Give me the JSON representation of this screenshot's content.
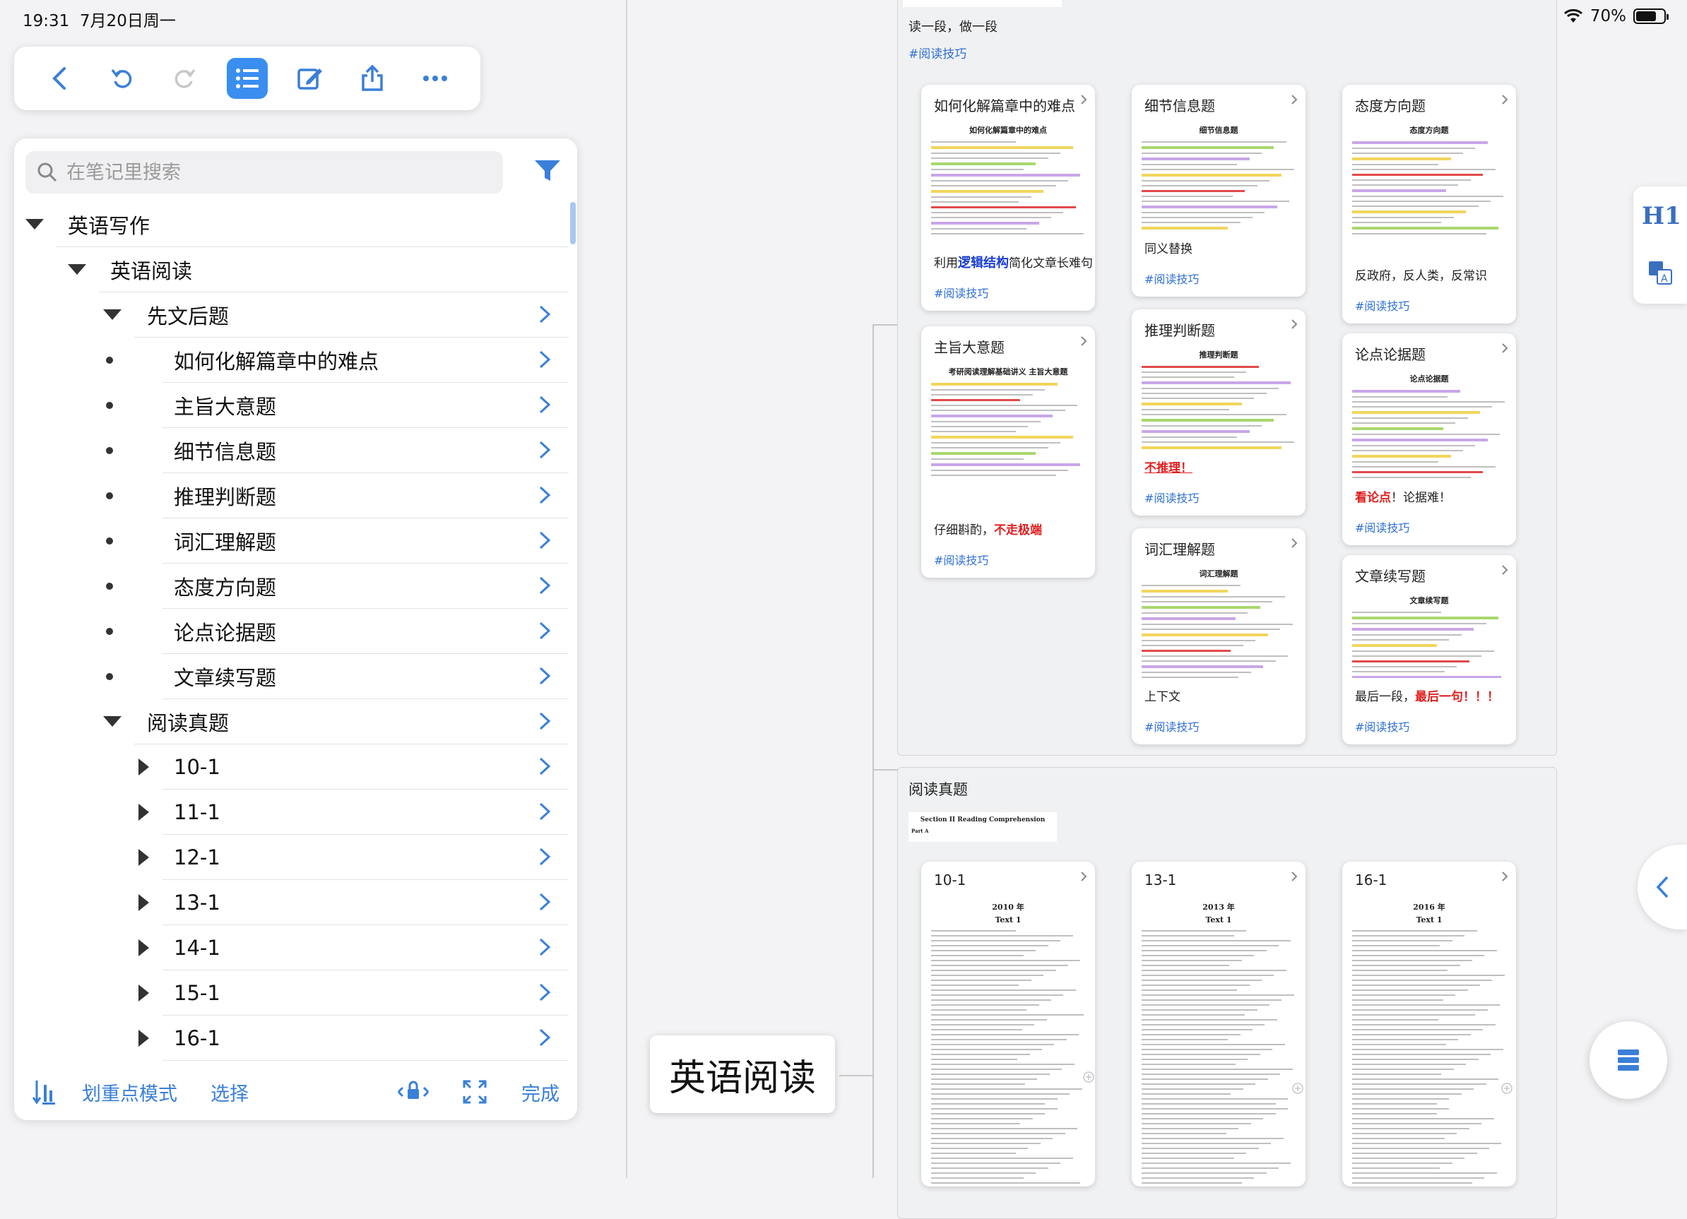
{
  "status": {
    "time": "19:31",
    "date": "7月20日周一",
    "battery": "70%",
    "battery_level": 0.7
  },
  "toolbar": {
    "items": [
      "back-icon",
      "undo-icon",
      "redo-icon",
      "outline-list-icon",
      "edit-icon",
      "share-icon",
      "more-icon"
    ],
    "accent": "#3a8ef0"
  },
  "search": {
    "placeholder": "在笔记里搜索"
  },
  "tree": {
    "root": "英语写作",
    "level1": "英语阅读",
    "group1": "先文后题",
    "group1_items": [
      "如何化解篇章中的难点",
      "主旨大意题",
      "细节信息题",
      "推理判断题",
      "词汇理解题",
      "态度方向题",
      "论点论据题",
      "文章续写题"
    ],
    "group2": "阅读真题",
    "group2_items": [
      "10-1",
      "11-1",
      "12-1",
      "13-1",
      "14-1",
      "15-1",
      "16-1"
    ]
  },
  "bottombar": {
    "highlight_mode": "划重点模式",
    "select": "选择",
    "done": "完成"
  },
  "canvas": {
    "top_partial_text": "读一段，做一段",
    "top_tag": "#阅读技巧",
    "cards": [
      {
        "title": "如何化解篇章中的难点",
        "thumb_title": "如何化解篇章中的难点",
        "note_prefix": "利用",
        "note_bold": "逻辑结构",
        "note_suffix": "简化文章长难句",
        "tag": "#阅读技巧"
      },
      {
        "title": "细节信息题",
        "thumb_title": "细节信息题",
        "note": "同义替换",
        "tag": "#阅读技巧"
      },
      {
        "title": "态度方向题",
        "thumb_title": "态度方向题",
        "note": "反政府，反人类，反常识",
        "tag": "#阅读技巧"
      },
      {
        "title": "主旨大意题",
        "thumb_title": "考研阅读理解基础讲义 主旨大意题",
        "note_prefix": "仔细斟酌，",
        "note_red": "不走极端",
        "tag": "#阅读技巧"
      },
      {
        "title": "推理判断题",
        "thumb_title": "推理判断题",
        "note_red": "不推理！",
        "tag": "#阅读技巧"
      },
      {
        "title": "论点论据题",
        "thumb_title": "论点论据题",
        "note_red": "看论点",
        "note_suffix": "！论据难！",
        "tag": "#阅读技巧"
      },
      {
        "title": "词汇理解题",
        "thumb_title": "词汇理解题",
        "note": "上下文",
        "tag": "#阅读技巧"
      },
      {
        "title": "文章续写题",
        "thumb_title": "文章续写题",
        "note_prefix": "最后一段，",
        "note_red": "最后一句！！！",
        "tag": "#阅读技巧"
      }
    ],
    "section2_title": "阅读真题",
    "section2_doc_title": "Section II Reading Comprehension",
    "section2_doc_part": "Part A",
    "exam_cards": [
      {
        "title": "10-1",
        "year": "2010 年",
        "text": "Text 1"
      },
      {
        "title": "13-1",
        "year": "2013 年",
        "text": "Text 1"
      },
      {
        "title": "16-1",
        "year": "2016 年",
        "text": "Text 1"
      }
    ],
    "root_node": "英语阅读"
  },
  "colors": {
    "accent": "#3a8ef0",
    "tag": "#2f6fd6",
    "red_note": "#e02020",
    "bold_blue": "#1a3fd0"
  }
}
